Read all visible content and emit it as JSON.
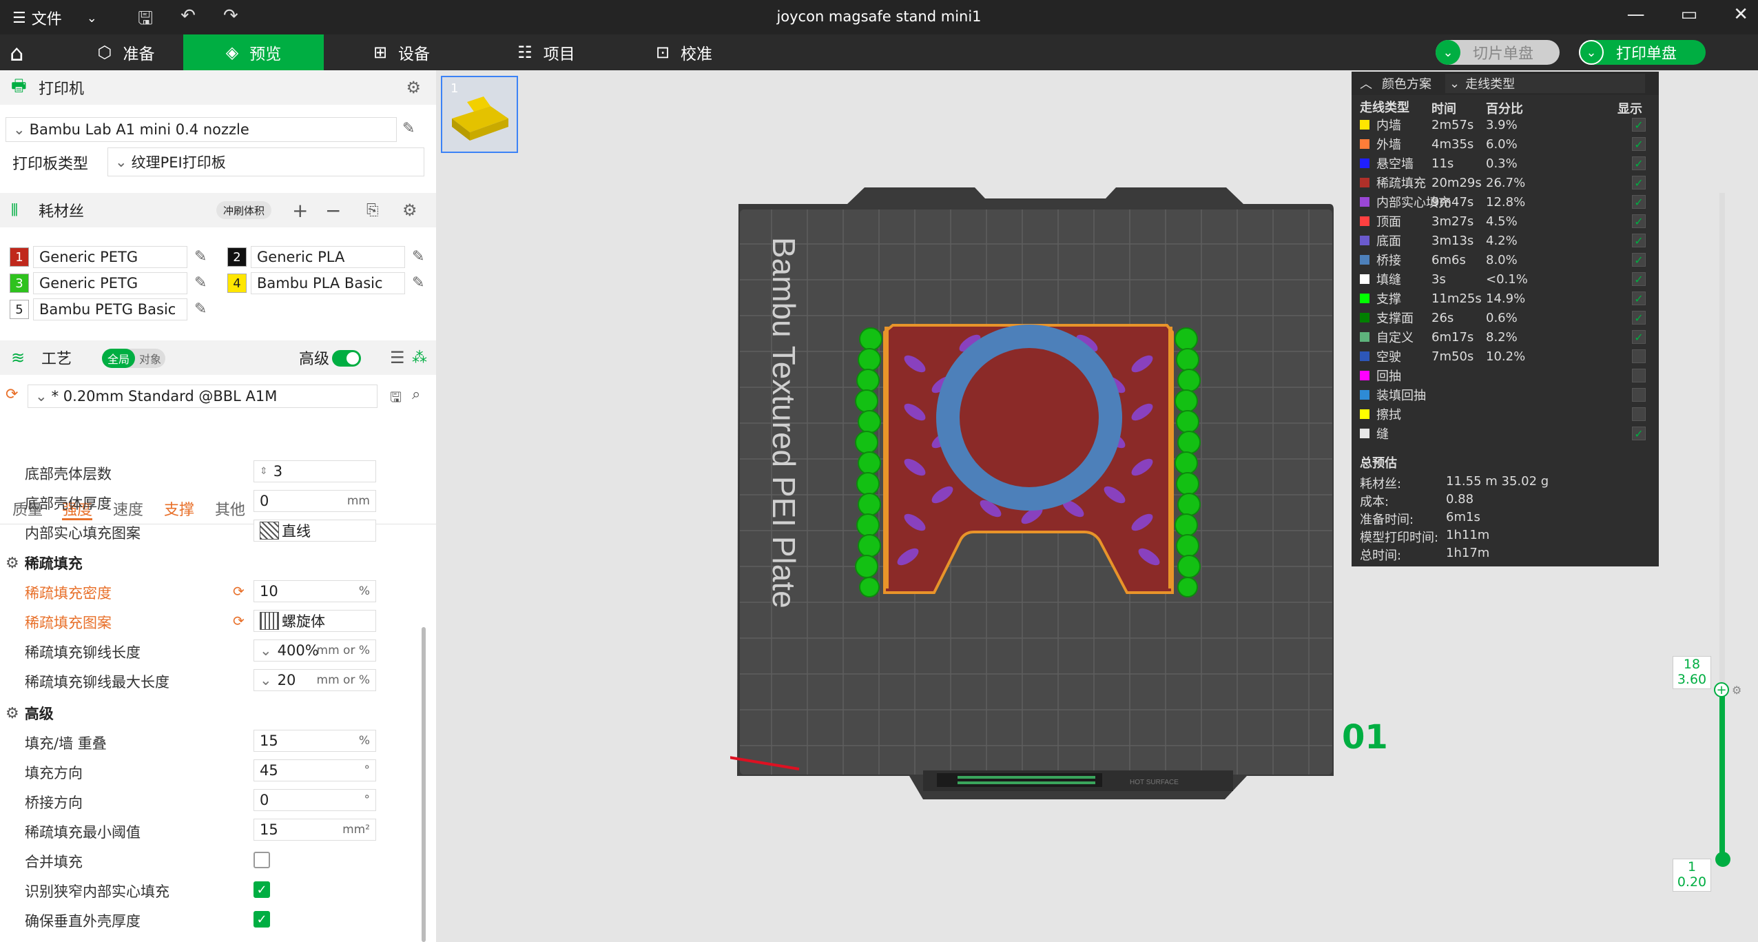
{
  "titlebar": {
    "menu_label": "文件",
    "title": "joycon magsafe stand mini1"
  },
  "tabs": {
    "prepare": "准备",
    "preview": "预览",
    "device": "设备",
    "project": "项目",
    "calibration": "校准",
    "slice_plate": "切片单盘",
    "print_plate": "打印单盘"
  },
  "printer": {
    "section_title": "打印机",
    "model": "Bambu Lab A1 mini 0.4 nozzle",
    "plate_type_label": "打印板类型",
    "plate_type": "纹理PEI打印板"
  },
  "filament": {
    "section_title": "耗材丝",
    "flush_label": "冲刷体积",
    "items": [
      {
        "num": "1",
        "name": "Generic PETG",
        "color": "#c0281c"
      },
      {
        "num": "2",
        "name": "Generic PLA",
        "color": "#111111"
      },
      {
        "num": "3",
        "name": "Generic PETG",
        "color": "#2ec21e"
      },
      {
        "num": "4",
        "name": "Bambu PLA Basic",
        "color": "#ffe600"
      },
      {
        "num": "5",
        "name": "Bambu PETG Basic",
        "color": "#ffffff"
      }
    ]
  },
  "process": {
    "section_title": "工艺",
    "global_label": "全局",
    "object_label": "对象",
    "advanced_label": "高级",
    "preset": "* 0.20mm Standard @BBL A1M",
    "subtabs": [
      "质量",
      "强度",
      "速度",
      "支撑",
      "其他"
    ]
  },
  "params": {
    "bottom_shell_layers": {
      "label": "底部壳体层数",
      "value": "3"
    },
    "bottom_shell_thickness": {
      "label": "底部壳体厚度",
      "value": "0",
      "unit": "mm"
    },
    "internal_solid_pattern": {
      "label": "内部实心填充图案",
      "value": "直线"
    },
    "sparse_group": "稀疏填充",
    "sparse_density": {
      "label": "稀疏填充密度",
      "value": "10",
      "unit": "%"
    },
    "sparse_pattern": {
      "label": "稀疏填充图案",
      "value": "螺旋体"
    },
    "anchor_length": {
      "label": "稀疏填充铆线长度",
      "value": "400%",
      "unit": "mm or %"
    },
    "anchor_max": {
      "label": "稀疏填充铆线最大长度",
      "value": "20",
      "unit": "mm or %"
    },
    "advanced_group": "高级",
    "infill_overlap": {
      "label": "填充/墙 重叠",
      "value": "15",
      "unit": "%"
    },
    "infill_direction": {
      "label": "填充方向",
      "value": "45",
      "unit": "°"
    },
    "bridge_direction": {
      "label": "桥接方向",
      "value": "0",
      "unit": "°"
    },
    "min_sparse": {
      "label": "稀疏填充最小阈值",
      "value": "15",
      "unit": "mm²"
    },
    "combine_infill": {
      "label": "合并填充"
    },
    "detect_narrow": {
      "label": "识别狭窄内部实心填充"
    },
    "ensure_vertical": {
      "label": "确保垂直外壳厚度"
    }
  },
  "legend": {
    "title": "颜色方案",
    "scheme": "走线类型",
    "headers": {
      "type": "走线类型",
      "time": "时间",
      "percent": "百分比",
      "show": "显示"
    },
    "rows": [
      {
        "name": "内墙",
        "time": "2m57s",
        "pct": "3.9%",
        "color": "#ffe600",
        "show": true
      },
      {
        "name": "外墙",
        "time": "4m35s",
        "pct": "6.0%",
        "color": "#ff7d38",
        "show": true
      },
      {
        "name": "悬空墙",
        "time": "11s",
        "pct": "0.3%",
        "color": "#1f1fff",
        "show": true
      },
      {
        "name": "稀疏填充",
        "time": "20m29s",
        "pct": "26.7%",
        "color": "#b03029",
        "show": true
      },
      {
        "name": "内部实心填充",
        "time": "9m47s",
        "pct": "12.8%",
        "color": "#9a47d6",
        "show": true
      },
      {
        "name": "顶面",
        "time": "3m27s",
        "pct": "4.5%",
        "color": "#ff4040",
        "show": true
      },
      {
        "name": "底面",
        "time": "3m13s",
        "pct": "4.2%",
        "color": "#6a5acd",
        "show": true
      },
      {
        "name": "桥接",
        "time": "6m6s",
        "pct": "8.0%",
        "color": "#4d80ba",
        "show": true
      },
      {
        "name": "填缝",
        "time": "3s",
        "pct": "<0.1%",
        "color": "#ffffff",
        "show": true
      },
      {
        "name": "支撑",
        "time": "11m25s",
        "pct": "14.9%",
        "color": "#00ff00",
        "show": true
      },
      {
        "name": "支撑面",
        "time": "26s",
        "pct": "0.6%",
        "color": "#008000",
        "show": true
      },
      {
        "name": "自定义",
        "time": "6m17s",
        "pct": "8.2%",
        "color": "#5eb37c",
        "show": true
      },
      {
        "name": "空驶",
        "time": "7m50s",
        "pct": "10.2%",
        "color": "#2d57b8",
        "show": false
      },
      {
        "name": "回抽",
        "time": "",
        "pct": "",
        "color": "#ff00ff",
        "show": false
      },
      {
        "name": "装填回抽",
        "time": "",
        "pct": "",
        "color": "#2e8bd6",
        "show": false
      },
      {
        "name": "擦拭",
        "time": "",
        "pct": "",
        "color": "#ffff00",
        "show": false
      },
      {
        "name": "缝",
        "time": "",
        "pct": "",
        "color": "#e6e6e6",
        "show": true
      }
    ],
    "summary_title": "总预估",
    "summary": [
      {
        "label": "耗材丝:",
        "value": "11.55 m    35.02 g"
      },
      {
        "label": "成本:",
        "value": "0.88"
      },
      {
        "label": "准备时间:",
        "value": "6m1s"
      },
      {
        "label": "模型打印时间:",
        "value": "1h11m"
      },
      {
        "label": "总时间:",
        "value": "1h17m"
      }
    ]
  },
  "viewport": {
    "plate_label": "Bambu Textured PEI Plate",
    "plate_number": "01",
    "thumb_number": "1",
    "bed_text": "HOT SURFACE"
  },
  "layer_slider": {
    "top_layer": "18",
    "top_height": "3.60",
    "bottom_layer": "1",
    "bottom_height": "0.20"
  }
}
